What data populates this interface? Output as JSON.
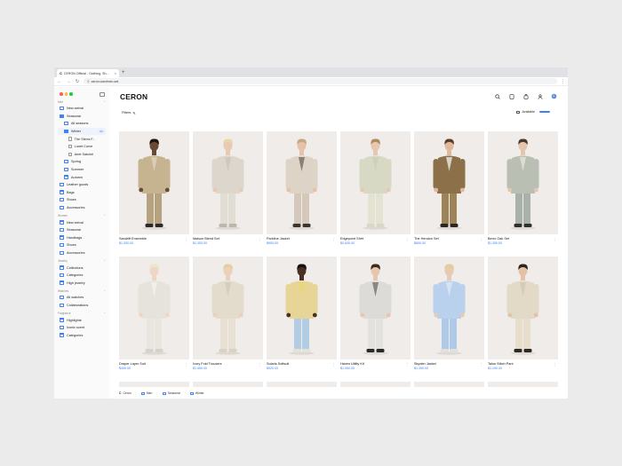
{
  "browser": {
    "tab_title": "CERON Official - Clothing, Sh...",
    "tab_favicon": "C",
    "url": "ceron.com/men-set"
  },
  "sidebar": {
    "sections": [
      {
        "label": "Men",
        "items": [
          {
            "label": "New arrival",
            "level": 1,
            "icon": "folder-icon"
          },
          {
            "label": "Seasonal",
            "level": 1,
            "icon": "folder-open-icon"
          },
          {
            "label": "All seasons",
            "level": 2,
            "icon": "folder-icon"
          },
          {
            "label": "Winter",
            "level": 2,
            "icon": "folder-open-icon",
            "badge": "02",
            "active": true
          },
          {
            "label": "The Sierra F...",
            "level": 3,
            "icon": "page-icon"
          },
          {
            "label": "Lunet Curve",
            "level": 3,
            "icon": "page-icon"
          },
          {
            "label": "Anet Satchel",
            "level": 3,
            "icon": "page-icon"
          },
          {
            "label": "Spring",
            "level": 2,
            "icon": "folder-icon"
          },
          {
            "label": "Summer",
            "level": 2,
            "icon": "folder-icon"
          },
          {
            "label": "Autumn",
            "level": 2,
            "icon": "folder-icon"
          },
          {
            "label": "Leather goods",
            "level": 1,
            "icon": "folder-icon"
          },
          {
            "label": "Bags",
            "level": 1,
            "icon": "folder-icon"
          },
          {
            "label": "Shoes",
            "level": 1,
            "icon": "folder-icon"
          },
          {
            "label": "Accessories",
            "level": 1,
            "icon": "folder-icon"
          }
        ]
      },
      {
        "label": "Women",
        "items": [
          {
            "label": "New arrival",
            "level": 1,
            "icon": "folder-icon"
          },
          {
            "label": "Seasonal",
            "level": 1,
            "icon": "folder-icon"
          },
          {
            "label": "Handbags",
            "level": 1,
            "icon": "folder-icon"
          },
          {
            "label": "Shoes",
            "level": 1,
            "icon": "folder-icon"
          },
          {
            "label": "Accessories",
            "level": 1,
            "icon": "folder-icon"
          }
        ]
      },
      {
        "label": "Jewelry",
        "items": [
          {
            "label": "Collections",
            "level": 1,
            "icon": "folder-icon"
          },
          {
            "label": "Categories",
            "level": 1,
            "icon": "folder-icon"
          },
          {
            "label": "High jewelry",
            "level": 1,
            "icon": "folder-icon"
          }
        ]
      },
      {
        "label": "Watches",
        "items": [
          {
            "label": "All watches",
            "level": 1,
            "icon": "folder-icon"
          },
          {
            "label": "Collaborations",
            "level": 1,
            "icon": "folder-icon"
          }
        ]
      },
      {
        "label": "Fragrance",
        "items": [
          {
            "label": "Highlights",
            "level": 1,
            "icon": "folder-icon"
          },
          {
            "label": "Iconic scent",
            "level": 1,
            "icon": "folder-icon"
          },
          {
            "label": "Categories",
            "level": 1,
            "icon": "folder-icon"
          }
        ]
      }
    ]
  },
  "header": {
    "logo": "CERON"
  },
  "filterbar": {
    "filters_label": "Filters",
    "available_label": "Available"
  },
  "products": [
    {
      "name": "Sandrift Ensemble",
      "price": "$1,390.00",
      "outfit": {
        "jacket": "#c6b491",
        "pants": "#b5a27e",
        "inner": "#d9cdb3",
        "skin": "#6b4a34",
        "hair": "#1a1612",
        "shoes": "#2b2a28"
      }
    },
    {
      "name": "Maison Blend Set",
      "price": "$1,350.00",
      "outfit": {
        "jacket": "#dcd6cc",
        "pants": "#e2ddd4",
        "inner": "#cfc8bc",
        "skin": "#e8c9b2",
        "hair": "#e8d8a8",
        "shoes": "#bdb6aa"
      }
    },
    {
      "name": "Parkline Jacket",
      "price": "$990.00",
      "outfit": {
        "jacket": "#ddd3c6",
        "pants": "#d3c8ba",
        "inner": "#8a7f72",
        "skin": "#e5c3aa",
        "hair": "#c6a880",
        "shoes": "#3a352f"
      }
    },
    {
      "name": "Edgepoint Shirt",
      "price": "$2,830.00",
      "outfit": {
        "jacket": "#d8d9c4",
        "pants": "#e4e3d2",
        "inner": "#cfd0b8",
        "skin": "#e7c7b0",
        "hair": "#b08a62",
        "shoes": "#d9d6c7"
      }
    },
    {
      "name": "The Hendon Set",
      "price": "$650.00",
      "outfit": {
        "jacket": "#8b7049",
        "pants": "#9e8358",
        "inner": "#d8d3c8",
        "skin": "#e1b89a",
        "hair": "#5c3f28",
        "shoes": "#2c2621"
      }
    },
    {
      "name": "Berro Oak Set",
      "price": "$1,390.00",
      "outfit": {
        "jacket": "#b9bfb3",
        "pants": "#a9b2aa",
        "inner": "#dcdcd4",
        "skin": "#e6c5ad",
        "hair": "#4a3a2c",
        "shoes": "#2f2f2d"
      }
    },
    {
      "name": "Draper Layer Suit",
      "price": "$450.00",
      "outfit": {
        "jacket": "#e6e3dc",
        "pants": "#e9e6df",
        "inner": "#f1efea",
        "skin": "#efd6c4",
        "hair": "#eee4c8",
        "shoes": "#d6d2c8"
      }
    },
    {
      "name": "Ivory Fold Trousers",
      "price": "$1,550.00",
      "outfit": {
        "jacket": "#e3dccd",
        "pants": "#e7e0d3",
        "inner": "#d5cdbd",
        "skin": "#ecd0bb",
        "hair": "#e3cf9d",
        "shoes": "#d9d2c4"
      }
    },
    {
      "name": "Solaris Softsuit",
      "price": "$920.00",
      "outfit": {
        "jacket": "#e7d597",
        "pants": "#b2cde3",
        "inner": "#e9d778",
        "skin": "#4a3022",
        "hair": "#141210",
        "shoes": "#e6e2d8"
      }
    },
    {
      "name": "Haven Utility Kit",
      "price": "$1,050.00",
      "outfit": {
        "jacket": "#dcdbd7",
        "pants": "#e3e2de",
        "inner": "#8a8680",
        "skin": "#e7c6ae",
        "hair": "#3b2a1e",
        "shoes": "#2a2928"
      }
    },
    {
      "name": "Skyden Jacket",
      "price": "$1,390.00",
      "outfit": {
        "jacket": "#b9d1ec",
        "pants": "#aecae8",
        "inner": "#d6e4f2",
        "skin": "#e8c9b3",
        "hair": "#e0cf9e",
        "shoes": "#e2e0da"
      }
    },
    {
      "name": "Talon Stitch Pant",
      "price": "$1,190.00",
      "outfit": {
        "jacket": "#e2d9c6",
        "pants": "#e6ddca",
        "inner": "#d6ccb6",
        "skin": "#e4c2a8",
        "hair": "#2e241c",
        "shoes": "#2b2825"
      }
    }
  ],
  "footer": {
    "crumbs": [
      {
        "label": "Ceron",
        "icon": "ceron-logo-icon"
      },
      {
        "label": "Men",
        "icon": "folder-icon"
      },
      {
        "label": "Seasonal",
        "icon": "folder-icon"
      },
      {
        "label": "Winter",
        "icon": "folder-icon"
      }
    ]
  }
}
